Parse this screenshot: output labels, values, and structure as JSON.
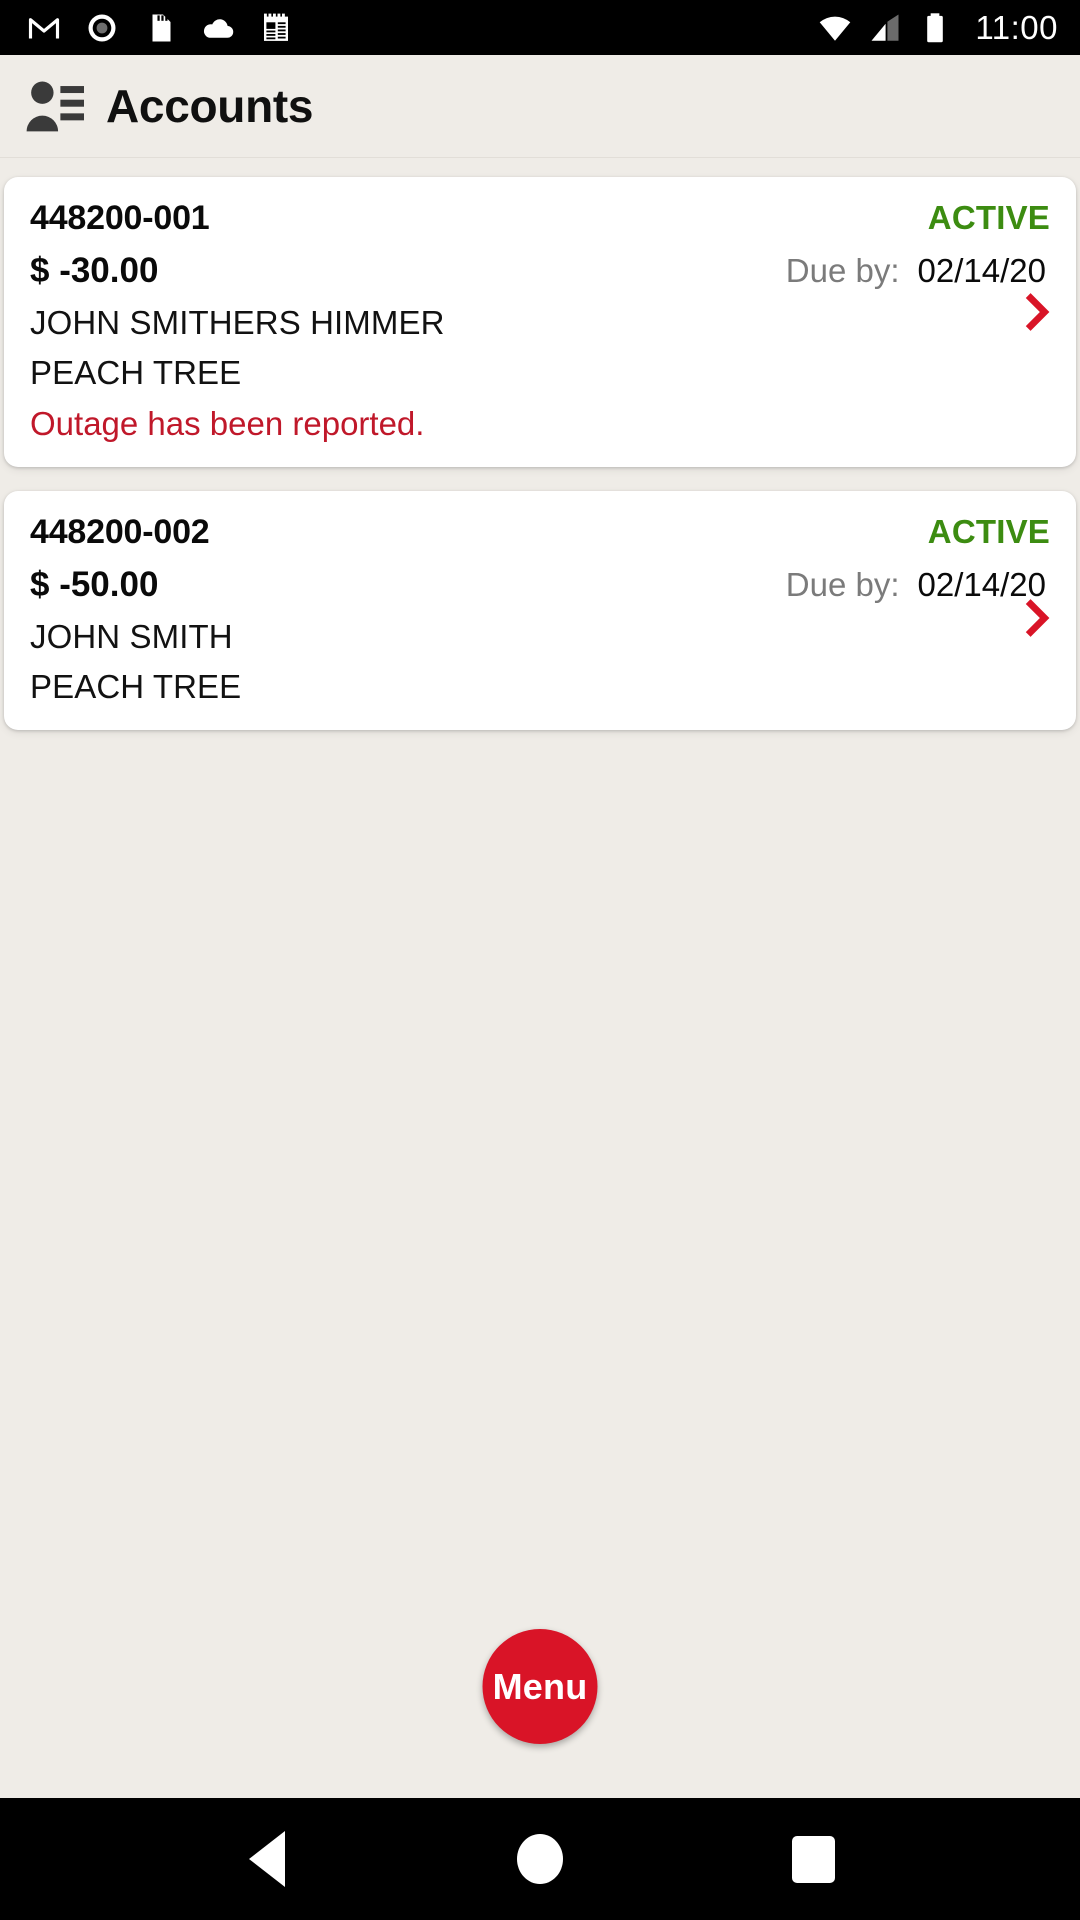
{
  "status_bar": {
    "time": "11:00",
    "left_icons": [
      "gmail-icon",
      "screen-record-icon",
      "sd-card-icon",
      "cloud-icon",
      "notes-icon"
    ],
    "right_icons": [
      "wifi-icon",
      "cellular-signal-icon",
      "battery-icon"
    ]
  },
  "header": {
    "title": "Accounts",
    "icon": "account-details-icon"
  },
  "colors": {
    "accent_red": "#d91427",
    "status_active": "#3c8c11",
    "outage_red": "#c0182a",
    "page_bg": "#efece7",
    "card_bg": "#ffffff"
  },
  "accounts": [
    {
      "number": "448200-001",
      "status": "ACTIVE",
      "amount": "$ -30.00",
      "due_label": "Due by:",
      "due_date": "02/14/20",
      "customer_name": "JOHN SMITHERS HIMMER",
      "address": "PEACH TREE",
      "notice": "Outage has been reported."
    },
    {
      "number": "448200-002",
      "status": "ACTIVE",
      "amount": "$ -50.00",
      "due_label": "Due by:",
      "due_date": "02/14/20",
      "customer_name": "JOHN SMITH",
      "address": "PEACH TREE",
      "notice": ""
    }
  ],
  "fab": {
    "label": "Menu"
  },
  "nav_bar": {
    "back": "back-icon",
    "home": "home-icon",
    "recents": "recents-icon"
  }
}
